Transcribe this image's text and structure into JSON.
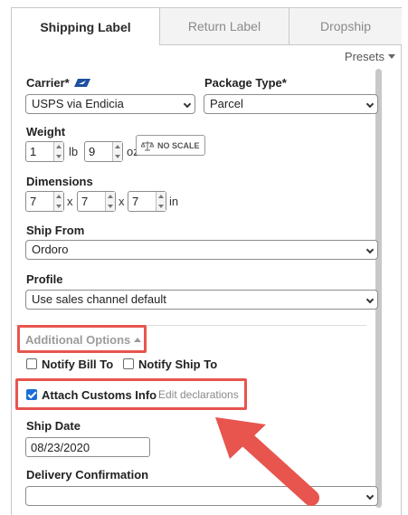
{
  "tabs": [
    {
      "label": "Shipping Label",
      "active": true
    },
    {
      "label": "Return Label",
      "active": false
    },
    {
      "label": "Dropship",
      "active": false
    }
  ],
  "presets_label": "Presets",
  "carrier": {
    "label": "Carrier*",
    "value": "USPS via Endicia",
    "icon": "usps-eagle-icon"
  },
  "package_type": {
    "label": "Package Type*",
    "value": "Parcel"
  },
  "weight": {
    "label": "Weight",
    "lb_value": "1",
    "lb_unit": "lb",
    "oz_value": "9",
    "oz_unit": "oz",
    "no_scale_label": "NO SCALE",
    "no_scale_icon": "scale-icon"
  },
  "dimensions": {
    "label": "Dimensions",
    "length": "7",
    "width": "7",
    "height": "7",
    "separator": "x",
    "unit": "in"
  },
  "ship_from": {
    "label": "Ship From",
    "value": "Ordoro"
  },
  "profile": {
    "label": "Profile",
    "value": "Use sales channel default"
  },
  "additional_options": {
    "label": "Additional Options"
  },
  "notify_bill_to": {
    "label": "Notify Bill To",
    "checked": false
  },
  "notify_ship_to": {
    "label": "Notify Ship To",
    "checked": false
  },
  "attach_customs": {
    "label": "Attach Customs Info",
    "checked": true,
    "edit_link": "Edit declarations"
  },
  "ship_date": {
    "label": "Ship Date",
    "value": "08/23/2020"
  },
  "delivery_confirmation": {
    "label": "Delivery Confirmation",
    "value": ""
  },
  "colors": {
    "highlight": "#e7554e",
    "checkbox_checked": "#1a6fd6",
    "usps_blue": "#1d4fa0"
  }
}
